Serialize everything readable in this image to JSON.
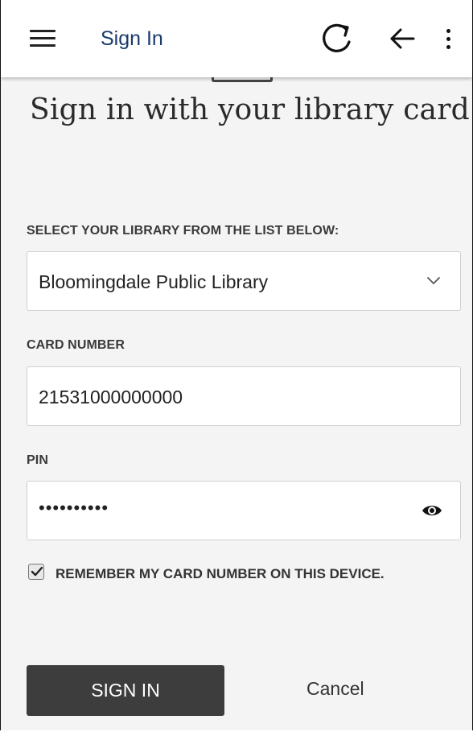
{
  "appbar": {
    "title": "Sign In",
    "icons": [
      "menu-icon",
      "refresh-icon",
      "back-arrow-icon",
      "more-vert-icon"
    ]
  },
  "page": {
    "heading": "Sign in with your library card"
  },
  "library": {
    "label": "SELECT YOUR LIBRARY FROM THE LIST BELOW:",
    "selected": "Bloomingdale Public Library"
  },
  "card": {
    "label": "CARD NUMBER",
    "value": "21531000000000"
  },
  "pin": {
    "label": "PIN",
    "masked_value": "••••••••••"
  },
  "remember": {
    "checked": true,
    "label": "REMEMBER MY CARD NUMBER ON THIS DEVICE."
  },
  "actions": {
    "sign_in_label": "SIGN IN",
    "cancel_label": "Cancel"
  },
  "colors": {
    "title": "#1a3a6b",
    "button_bg": "#3d3d3d",
    "page_bg": "#f4f4f4"
  }
}
